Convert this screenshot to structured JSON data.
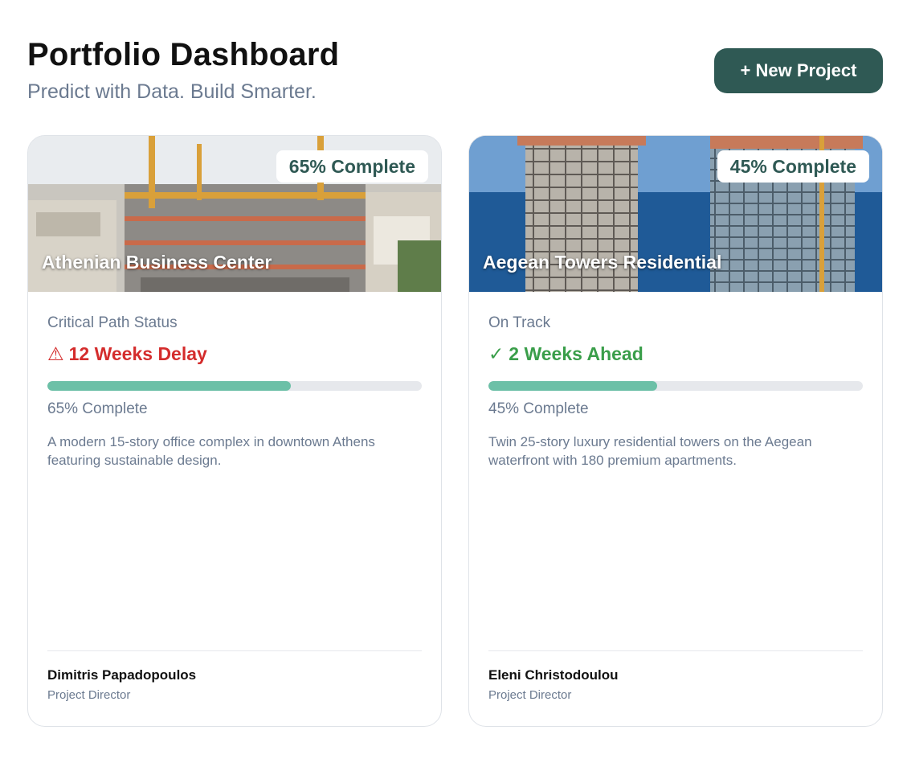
{
  "header": {
    "title": "Portfolio Dashboard",
    "subtitle": "Predict with Data. Build Smarter."
  },
  "actions": {
    "new_project_label": "+ New Project"
  },
  "colors": {
    "brand": "#2f5954",
    "progress": "#6cc0a7",
    "delay": "#d42c2c",
    "ahead": "#3a9e4a",
    "muted": "#6b7a90"
  },
  "projects": [
    {
      "name": "Athenian Business Center",
      "badge": "65% Complete",
      "status_label": "Critical Path Status",
      "status_icon": "warning-icon",
      "status_glyph": "⚠",
      "status_text": "12 Weeks Delay",
      "progress": 65,
      "progress_text": "65% Complete",
      "description": "A modern 15-story office complex in downtown Athens featuring sustainable design.",
      "person_name": "Dimitris Papadopoulos",
      "person_role": "Project Director"
    },
    {
      "name": "Aegean Towers Residential",
      "badge": "45% Complete",
      "status_label": "On Track",
      "status_icon": "checkmark-icon",
      "status_glyph": "✓",
      "status_text": "2 Weeks Ahead",
      "progress": 45,
      "progress_text": "45% Complete",
      "description": "Twin 25-story luxury residential towers on the Aegean waterfront with 180 premium apartments.",
      "person_name": "Eleni Christodoulou",
      "person_role": "Project Director"
    }
  ]
}
